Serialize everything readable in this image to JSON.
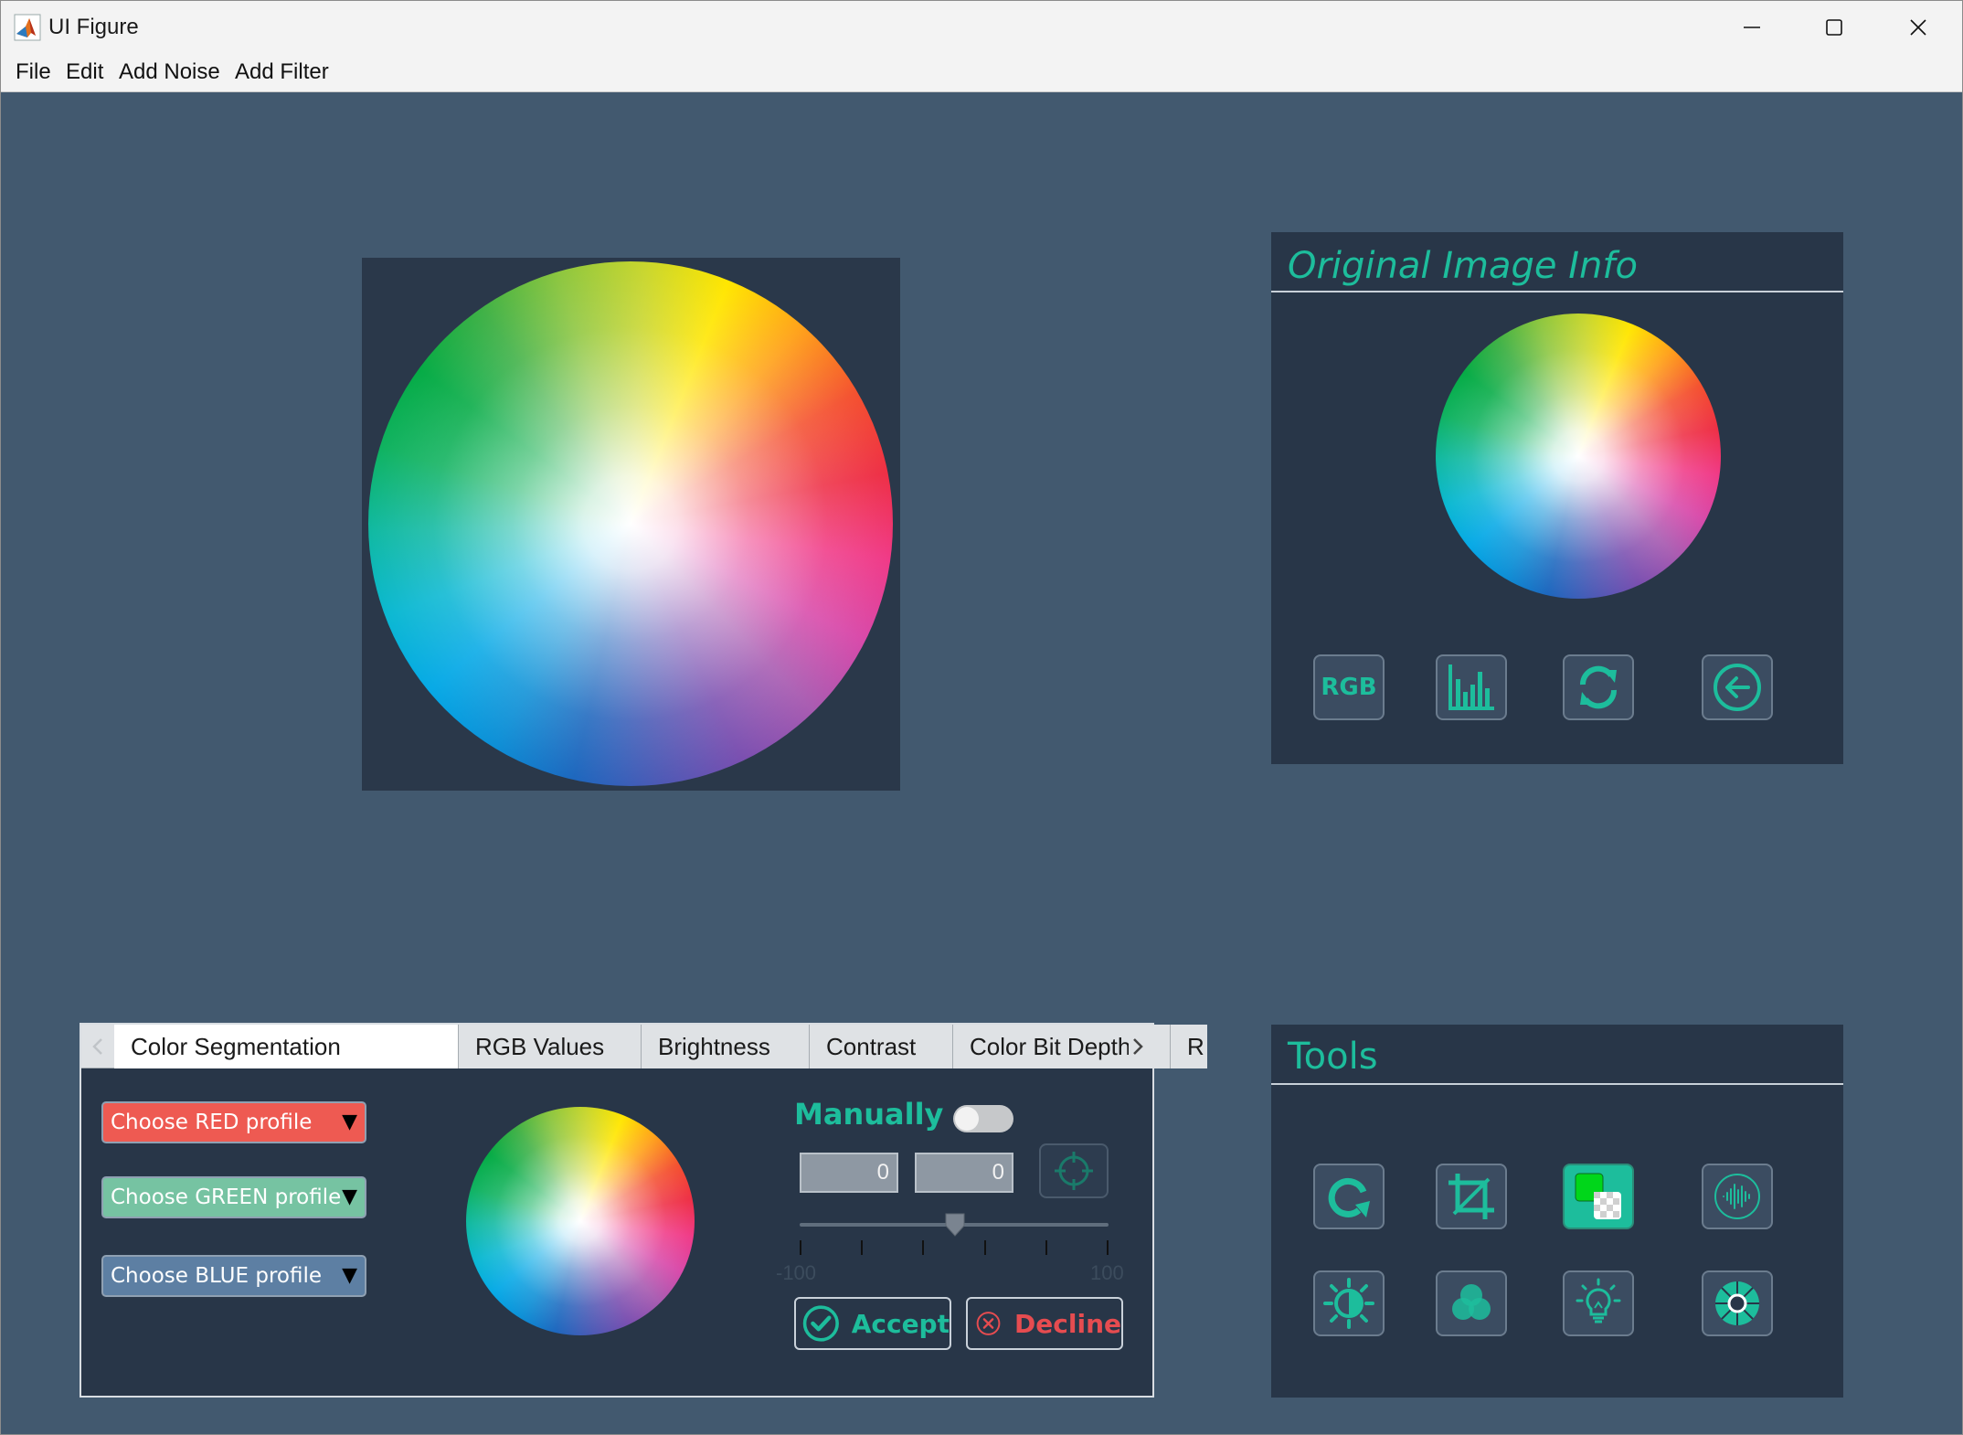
{
  "window": {
    "title": "UI Figure",
    "controls": [
      "minimize",
      "maximize",
      "close"
    ]
  },
  "menubar": {
    "items": [
      "File",
      "Edit",
      "Add Noise",
      "Add Filter"
    ]
  },
  "info_panel": {
    "title": "Original Image Info",
    "buttons": [
      {
        "name": "rgb-button",
        "label": "RGB"
      },
      {
        "name": "histogram-button",
        "icon": "histogram-icon"
      },
      {
        "name": "refresh-button",
        "icon": "refresh-icon"
      },
      {
        "name": "back-button",
        "icon": "arrow-left-icon"
      }
    ]
  },
  "tools_panel": {
    "title": "Tools",
    "buttons": [
      {
        "name": "rotate-button",
        "icon": "rotate-icon"
      },
      {
        "name": "crop-button",
        "icon": "crop-icon"
      },
      {
        "name": "background-removal-button",
        "icon": "chroma-key-icon"
      },
      {
        "name": "noise-button",
        "icon": "sound-wave-icon"
      },
      {
        "name": "contrast-button",
        "icon": "contrast-sun-icon"
      },
      {
        "name": "color-channels-button",
        "icon": "rgb-circles-icon"
      },
      {
        "name": "brightness-button",
        "icon": "lightbulb-icon"
      },
      {
        "name": "color-wheel-button",
        "icon": "color-wheel-icon"
      }
    ]
  },
  "tabs": {
    "items": [
      "Color Segmentation",
      "RGB Values",
      "Brightness",
      "Contrast",
      "Color Bit Depth",
      "R"
    ],
    "active": "Color Segmentation"
  },
  "segmentation": {
    "red_profile": "Choose RED profile",
    "green_profile": "Choose GREEN profile",
    "blue_profile": "Choose BLUE profile",
    "manually_label": "Manually",
    "manually_on": false,
    "min_value": "0",
    "max_value": "0",
    "slider": {
      "min_label": "-100",
      "max_label": "100",
      "value": 0
    },
    "accept_label": "Accept",
    "decline_label": "Decline"
  },
  "colors": {
    "background": "#42596f",
    "panel": "#283648",
    "accent": "#1dbd9c",
    "decline": "#e64c50",
    "red_profile": "#ee5a52",
    "green_profile": "#76c3a2",
    "blue_profile": "#5d7fa3"
  }
}
